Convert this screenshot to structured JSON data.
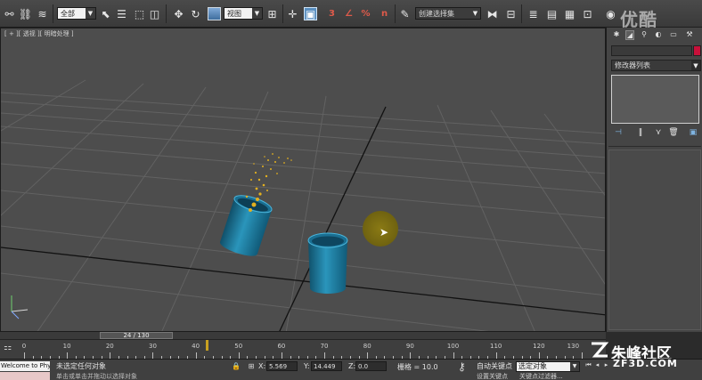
{
  "toolbar": {
    "filter_combo": "全部",
    "refcoord_combo": "视图",
    "named_selection": "创建选择集",
    "watermark": "优酷",
    "snap_label": "3",
    "angle_label": "∠",
    "percent_label": "%",
    "spinner_label": "n"
  },
  "viewport": {
    "label": "[ + ][ 透视 ][ 明暗处理 ]"
  },
  "command_panel": {
    "modifier_list": "修改器列表",
    "color_swatch": "#c8103a"
  },
  "timeline": {
    "slider_text": "24 / 130",
    "current_frame": 24,
    "total_frames": 130,
    "ticks": [
      "0",
      "10",
      "20",
      "30",
      "40",
      "50",
      "60",
      "70",
      "80",
      "90",
      "100",
      "110",
      "120",
      "130"
    ],
    "logo_text": "朱峰社区",
    "logo_sub": "ZF3D.COM"
  },
  "status": {
    "maxscript_text": "Welcome to Physics !",
    "prompt_text": "未选定任何对象",
    "prompt_hint": "单击或单击并拖动以选择对象",
    "x_label": "X:",
    "x_value": "5.569",
    "y_label": "Y:",
    "y_value": "14.449",
    "z_label": "Z:",
    "z_value": "0.0",
    "grid_text": "栅格 = 10.0",
    "autokey_label": "自动关键点",
    "selection_set": "选定对象",
    "setkey_label": "设置关键点",
    "keyfilter_label": "关键点过滤器..."
  },
  "colors": {
    "viewport_bg": "#4d4d4d",
    "cup_blue": "#1f7ea0",
    "particle_gold": "#e2b020"
  }
}
